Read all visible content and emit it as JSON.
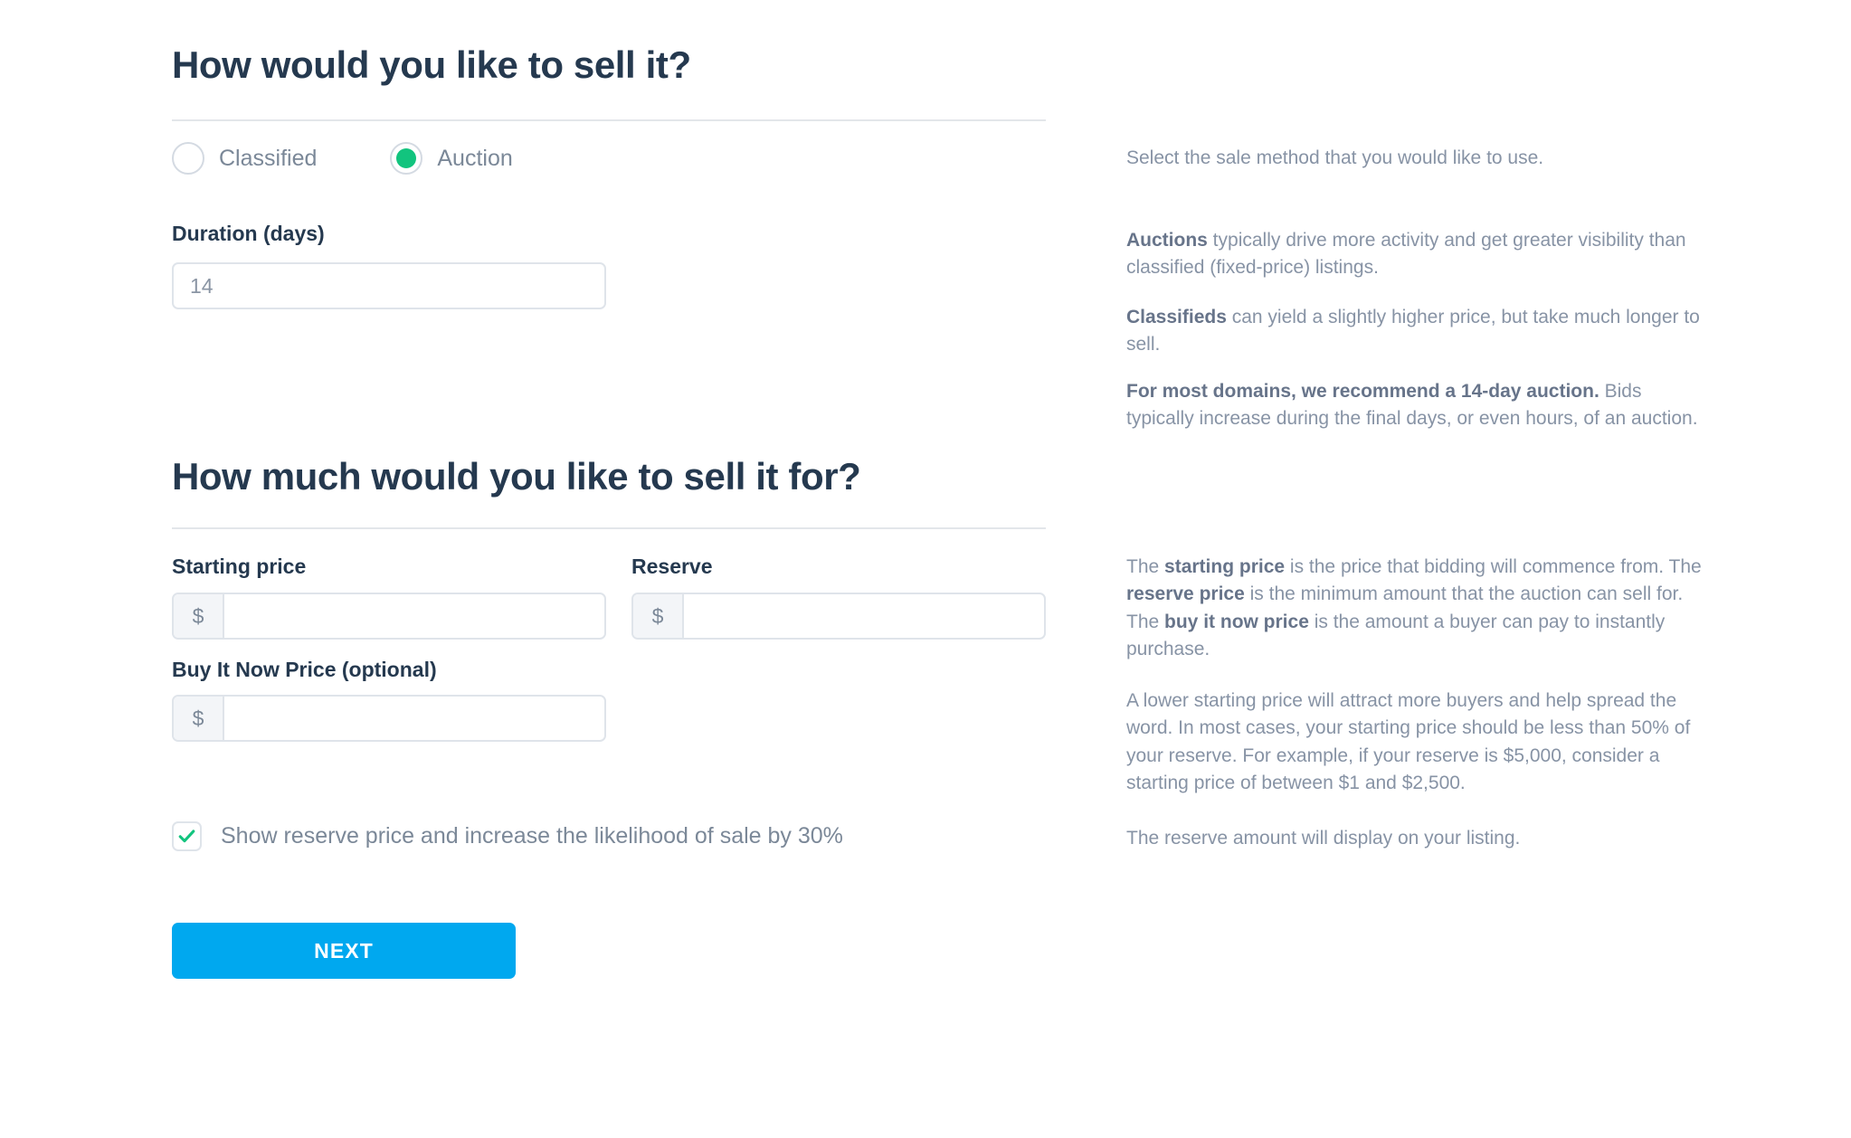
{
  "colors": {
    "heading": "#25394f",
    "muted_text": "#7b8898",
    "help_text": "#8793a5",
    "help_bold": "#67748a",
    "accent_green": "#12c47e",
    "accent_blue": "#00a8ef",
    "border": "#dfe4ea",
    "divider": "#e3e6ea",
    "prefix_bg": "#f3f5f8"
  },
  "sale_method_section": {
    "heading": "How would you like to sell it?",
    "options": [
      {
        "label": "Classified",
        "selected": false
      },
      {
        "label": "Auction",
        "selected": true
      }
    ],
    "duration": {
      "label": "Duration (days)",
      "value": "14",
      "placeholder": "14"
    }
  },
  "price_section": {
    "heading": "How much would you like to sell it for?",
    "starting_price": {
      "label": "Starting price",
      "prefix": "$",
      "value": "",
      "placeholder": ""
    },
    "reserve": {
      "label": "Reserve",
      "prefix": "$",
      "value": "",
      "placeholder": ""
    },
    "buy_it_now": {
      "label": "Buy It Now Price (optional)",
      "prefix": "$",
      "value": "",
      "placeholder": ""
    },
    "show_reserve_checkbox": {
      "label": "Show reserve price and increase the likelihood of sale by 30%",
      "checked": true
    }
  },
  "actions": {
    "next_label": "NEXT"
  },
  "help_panel": {
    "sale_method": [
      {
        "id": "select-method",
        "parts": [
          {
            "text": "Select the sale method that you would like to use.",
            "bold": false
          }
        ]
      },
      {
        "id": "auctions",
        "parts": [
          {
            "text": "Auctions",
            "bold": true
          },
          {
            "text": " typically drive more activity and get greater visibility than classified (fixed-price) listings.",
            "bold": false
          }
        ]
      },
      {
        "id": "classifieds",
        "parts": [
          {
            "text": "Classifieds",
            "bold": true
          },
          {
            "text": " can yield a slightly higher price, but take much longer to sell.",
            "bold": false
          }
        ]
      },
      {
        "id": "recommendation",
        "parts": [
          {
            "text": "For most domains, we recommend a 14-day auction.",
            "bold": true
          },
          {
            "text": " Bids typically increase during the final days, or even hours, of an auction.",
            "bold": false
          }
        ]
      }
    ],
    "pricing": [
      {
        "id": "price-definitions",
        "parts": [
          {
            "text": "The ",
            "bold": false
          },
          {
            "text": "starting price",
            "bold": true
          },
          {
            "text": " is the price that bidding will commence from. The ",
            "bold": false
          },
          {
            "text": "reserve price",
            "bold": true
          },
          {
            "text": " is the minimum amount that the auction can sell for. The ",
            "bold": false
          },
          {
            "text": "buy it now price",
            "bold": true
          },
          {
            "text": " is the amount a buyer can pay to instantly purchase.",
            "bold": false
          }
        ]
      },
      {
        "id": "lower-start-advice",
        "parts": [
          {
            "text": "A lower starting price will attract more buyers and help spread the word. In most cases, your starting price should be less than 50% of your reserve. For example, if your reserve is $5,000, consider a starting price of between $1 and $2,500.",
            "bold": false
          }
        ]
      },
      {
        "id": "reserve-display",
        "parts": [
          {
            "text": "The reserve amount will display on your listing.",
            "bold": false
          }
        ]
      }
    ]
  }
}
